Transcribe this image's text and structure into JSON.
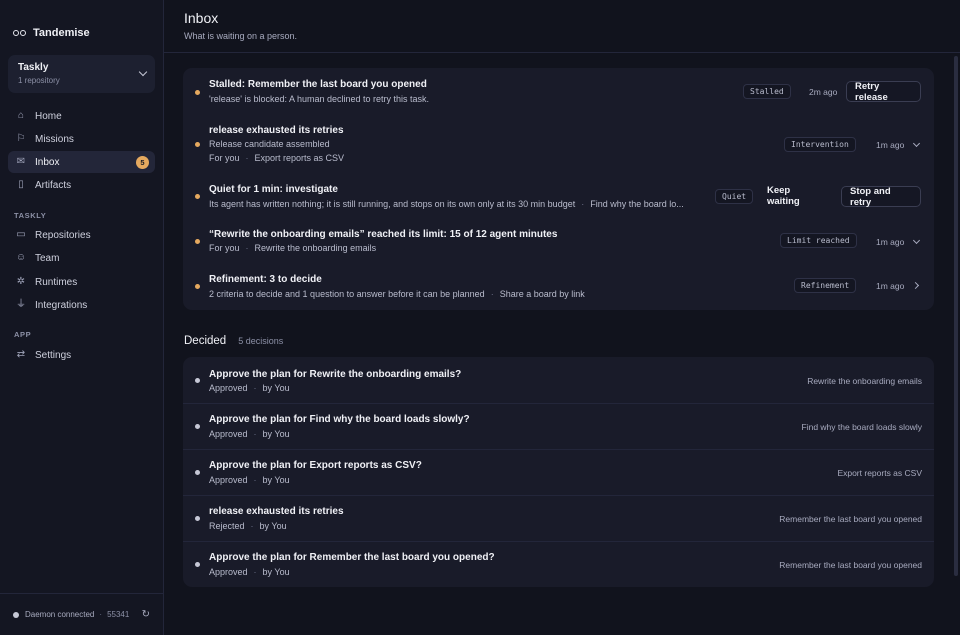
{
  "app": {
    "name": "Tandemise"
  },
  "workspace": {
    "name": "Taskly",
    "sub": "1 repository"
  },
  "nav": {
    "home": "Home",
    "missions": "Missions",
    "inbox": "Inbox",
    "inbox_badge": "5",
    "artifacts": "Artifacts",
    "section_taskly": "TASKLY",
    "repositories": "Repositories",
    "team": "Team",
    "runtimes": "Runtimes",
    "integrations": "Integrations",
    "section_app": "APP",
    "settings": "Settings"
  },
  "status": {
    "text": "Daemon connected",
    "port": "55341"
  },
  "header": {
    "title": "Inbox",
    "subtitle": "What is waiting on a person."
  },
  "pending": [
    {
      "title": "Stalled: Remember the last board you opened",
      "line": "'release' is blocked: A human declined to retry this task.",
      "tag": "Stalled",
      "time": "2m ago",
      "action": "Retry release"
    },
    {
      "title": "release exhausted its retries",
      "line1": "Release candidate assembled",
      "meta_a": "For you",
      "meta_b": "Export reports as CSV",
      "tag": "Intervention",
      "time": "1m ago"
    },
    {
      "title": "Quiet for 1 min: investigate",
      "line_a": "Its agent has written nothing; it is still running, and stops on its own only at its 30 min budget",
      "line_b": "Find why the board lo...",
      "tag": "Quiet",
      "action_secondary": "Keep waiting",
      "action": "Stop and retry"
    },
    {
      "title": "“Rewrite the onboarding emails” reached its limit: 15 of 12 agent minutes",
      "meta_a": "For you",
      "meta_b": "Rewrite the onboarding emails",
      "tag": "Limit reached",
      "time": "1m ago"
    },
    {
      "title": "Refinement: 3 to decide",
      "line_a": "2 criteria to decide and 1 question to answer before it can be planned",
      "line_b": "Share a board by link",
      "tag": "Refinement",
      "time": "1m ago"
    }
  ],
  "decided": {
    "title": "Decided",
    "count": "5 decisions",
    "items": [
      {
        "title": "Approve the plan for Rewrite the onboarding emails?",
        "status": "Approved",
        "by": "by",
        "who": "You",
        "mission": "Rewrite the onboarding emails"
      },
      {
        "title": "Approve the plan for Find why the board loads slowly?",
        "status": "Approved",
        "by": "by",
        "who": "You",
        "mission": "Find why the board loads slowly"
      },
      {
        "title": "Approve the plan for Export reports as CSV?",
        "status": "Approved",
        "by": "by",
        "who": "You",
        "mission": "Export reports as CSV"
      },
      {
        "title": "release exhausted its retries",
        "status": "Rejected",
        "by": "by",
        "who": "You",
        "mission": "Remember the last board you opened"
      },
      {
        "title": "Approve the plan for Remember the last board you opened?",
        "status": "Approved",
        "by": "by",
        "who": "You",
        "mission": "Remember the last board you opened"
      }
    ]
  },
  "colors": {
    "accent": "#e5a95f",
    "background": "#11131d",
    "card": "#191b29"
  }
}
